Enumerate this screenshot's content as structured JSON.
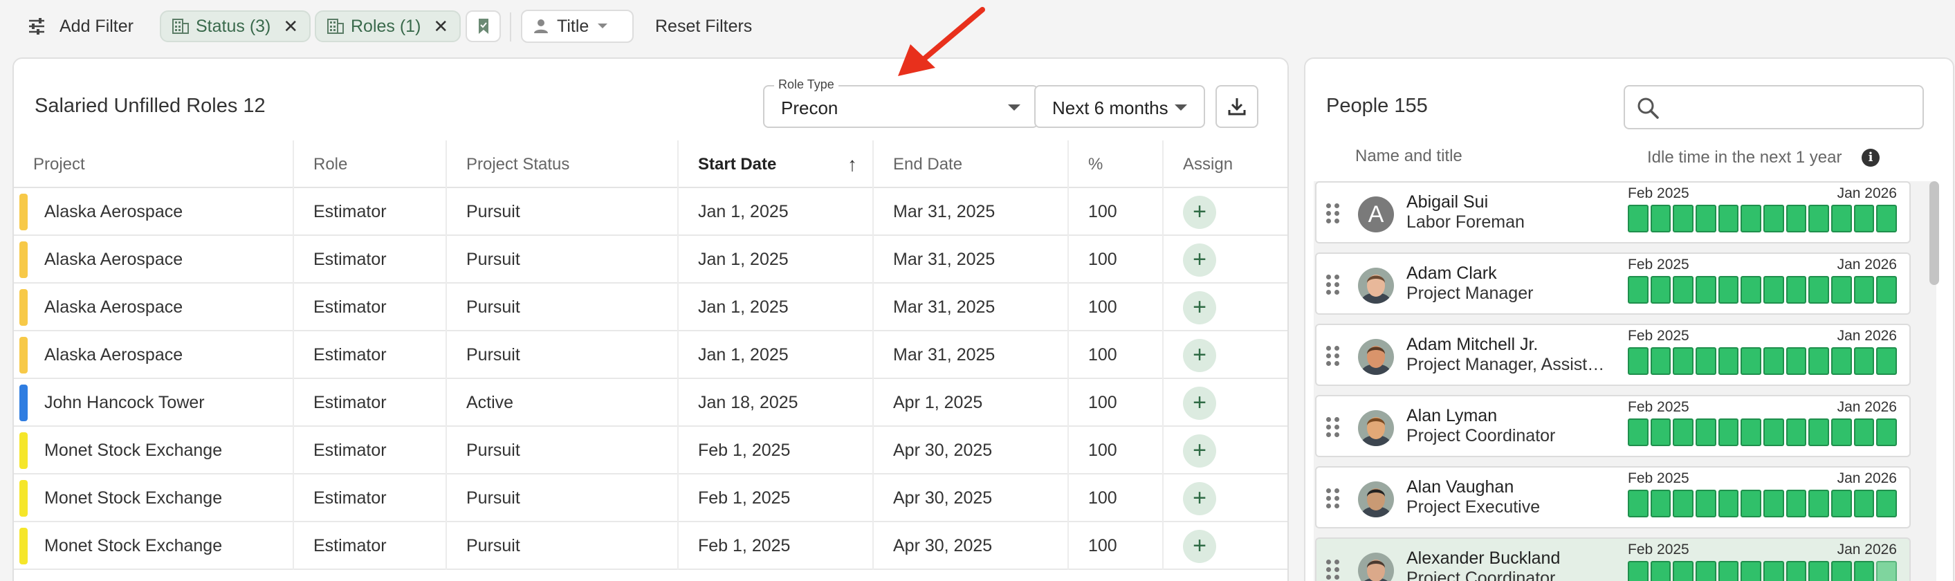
{
  "filterbar": {
    "add_filter": "Add Filter",
    "chips": [
      {
        "label": "Status (3)"
      },
      {
        "label": "Roles (1)"
      }
    ],
    "title_select": "Title",
    "reset_filters": "Reset Filters"
  },
  "unfilled": {
    "title": "Salaried Unfilled Roles 12",
    "role_type_label": "Role Type",
    "role_type_value": "Precon",
    "period_value": "Next 6 months",
    "columns": [
      "Project",
      "Role",
      "Project Status",
      "Start Date",
      "End Date",
      "%",
      "Assign"
    ],
    "sort_indicator": "↑",
    "rows": [
      {
        "project": "Alaska Aerospace",
        "role": "Estimator",
        "status": "Pursuit",
        "start": "Jan 1, 2025",
        "end": "Mar 31, 2025",
        "pct": "100",
        "color": "#f7c948"
      },
      {
        "project": "Alaska Aerospace",
        "role": "Estimator",
        "status": "Pursuit",
        "start": "Jan 1, 2025",
        "end": "Mar 31, 2025",
        "pct": "100",
        "color": "#f7c948"
      },
      {
        "project": "Alaska Aerospace",
        "role": "Estimator",
        "status": "Pursuit",
        "start": "Jan 1, 2025",
        "end": "Mar 31, 2025",
        "pct": "100",
        "color": "#f7c948"
      },
      {
        "project": "Alaska Aerospace",
        "role": "Estimator",
        "status": "Pursuit",
        "start": "Jan 1, 2025",
        "end": "Mar 31, 2025",
        "pct": "100",
        "color": "#f7c948"
      },
      {
        "project": "John Hancock Tower",
        "role": "Estimator",
        "status": "Active",
        "start": "Jan 18, 2025",
        "end": "Apr 1, 2025",
        "pct": "100",
        "color": "#2f7de1"
      },
      {
        "project": "Monet Stock Exchange",
        "role": "Estimator",
        "status": "Pursuit",
        "start": "Feb 1, 2025",
        "end": "Apr 30, 2025",
        "pct": "100",
        "color": "#f5e62a"
      },
      {
        "project": "Monet Stock Exchange",
        "role": "Estimator",
        "status": "Pursuit",
        "start": "Feb 1, 2025",
        "end": "Apr 30, 2025",
        "pct": "100",
        "color": "#f5e62a"
      },
      {
        "project": "Monet Stock Exchange",
        "role": "Estimator",
        "status": "Pursuit",
        "start": "Feb 1, 2025",
        "end": "Apr 30, 2025",
        "pct": "100",
        "color": "#f5e62a"
      }
    ],
    "assign_symbol": "+"
  },
  "people": {
    "title": "People 155",
    "search_placeholder": "",
    "head_name": "Name and title",
    "head_idle": "Idle time in the next 1 year",
    "info_symbol": "i",
    "range_start": "Feb 2025",
    "range_end": "Jan 2026",
    "list": [
      {
        "name": "Abigail Sui",
        "title": "Labor Foreman",
        "initial": "A",
        "avatar": "letter"
      },
      {
        "name": "Adam Clark",
        "title": "Project Manager",
        "avatar": "photo",
        "skin": "#e8b89a",
        "hair": "#6b4a33"
      },
      {
        "name": "Adam Mitchell Jr.",
        "title": "Project Manager, Assist…",
        "avatar": "photo",
        "skin": "#d9946b",
        "hair": "#5a3a25"
      },
      {
        "name": "Alan Lyman",
        "title": "Project Coordinator",
        "avatar": "photo",
        "skin": "#e2a877",
        "hair": "#7a4a22"
      },
      {
        "name": "Alan Vaughan",
        "title": "Project Executive",
        "avatar": "photo",
        "skin": "#c99a74",
        "hair": "#222222"
      },
      {
        "name": "Alexander Buckland",
        "title": "Project Coordinator",
        "avatar": "photo",
        "skin": "#dba98a",
        "hair": "#4a3a30",
        "selected": true
      }
    ]
  },
  "colors": {
    "accent_green": "#30c06a",
    "assign_bg": "#dcebe0",
    "annotation_arrow": "#e8301c"
  }
}
